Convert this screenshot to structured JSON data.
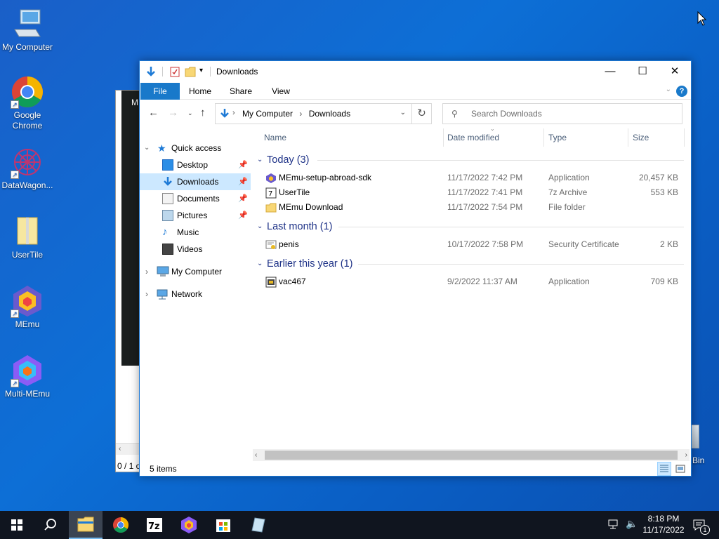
{
  "desktop": {
    "icons": [
      {
        "name": "desktop-icon-my-computer",
        "label": "My Computer"
      },
      {
        "name": "desktop-icon-google-chrome",
        "label": "Google Chrome"
      },
      {
        "name": "desktop-icon-datawagon",
        "label": "DataWagon..."
      },
      {
        "name": "desktop-icon-usertile",
        "label": "UserTile"
      },
      {
        "name": "desktop-icon-memu",
        "label": "MEmu"
      },
      {
        "name": "desktop-icon-multi-memu",
        "label": "Multi-MEmu"
      }
    ],
    "recycle_label": "Bin"
  },
  "bg_window": {
    "title_partial": "M",
    "status_partial": "0 / 1 o"
  },
  "explorer": {
    "title": "Downloads",
    "tabs": [
      "File",
      "Home",
      "Share",
      "View"
    ],
    "help": "?",
    "address": {
      "crumbs": [
        "My Computer",
        "›",
        "Downloads"
      ],
      "root_sep": "›"
    },
    "search_placeholder": "Search Downloads",
    "nav": [
      {
        "label": "Quick access",
        "level": 0,
        "expand": "⌄"
      },
      {
        "label": "Desktop",
        "level": 1,
        "pinned": true
      },
      {
        "label": "Downloads",
        "level": 1,
        "pinned": true,
        "selected": true
      },
      {
        "label": "Documents",
        "level": 1,
        "pinned": true
      },
      {
        "label": "Pictures",
        "level": 1,
        "pinned": true
      },
      {
        "label": "Music",
        "level": 1
      },
      {
        "label": "Videos",
        "level": 1
      },
      {
        "label": "My Computer",
        "level": 0,
        "expand": "›"
      },
      {
        "label": "Network",
        "level": 0,
        "expand": "›"
      }
    ],
    "columns": [
      "Name",
      "Date modified",
      "Type",
      "Size"
    ],
    "groups": [
      {
        "label": "Today (3)",
        "rows": [
          {
            "icon": "memu-app-icon",
            "name": "MEmu-setup-abroad-sdk",
            "date": "11/17/2022 7:42 PM",
            "type": "Application",
            "size": "20,457 KB"
          },
          {
            "icon": "7z-archive-icon",
            "name": "UserTile",
            "date": "11/17/2022 7:41 PM",
            "type": "7z Archive",
            "size": "553 KB"
          },
          {
            "icon": "folder-icon",
            "name": "MEmu Download",
            "date": "11/17/2022 7:54 PM",
            "type": "File folder",
            "size": ""
          }
        ]
      },
      {
        "label": "Last month (1)",
        "rows": [
          {
            "icon": "certificate-icon",
            "name": "penis",
            "date": "10/17/2022 7:58 PM",
            "type": "Security Certificate",
            "size": "2 KB"
          }
        ]
      },
      {
        "label": "Earlier this year (1)",
        "rows": [
          {
            "icon": "application-icon",
            "name": "vac467",
            "date": "9/2/2022 11:37 AM",
            "type": "Application",
            "size": "709 KB"
          }
        ]
      }
    ],
    "status": "5 items"
  },
  "taskbar": {
    "time": "8:18 PM",
    "date": "11/17/2022",
    "notif_count": "1"
  }
}
